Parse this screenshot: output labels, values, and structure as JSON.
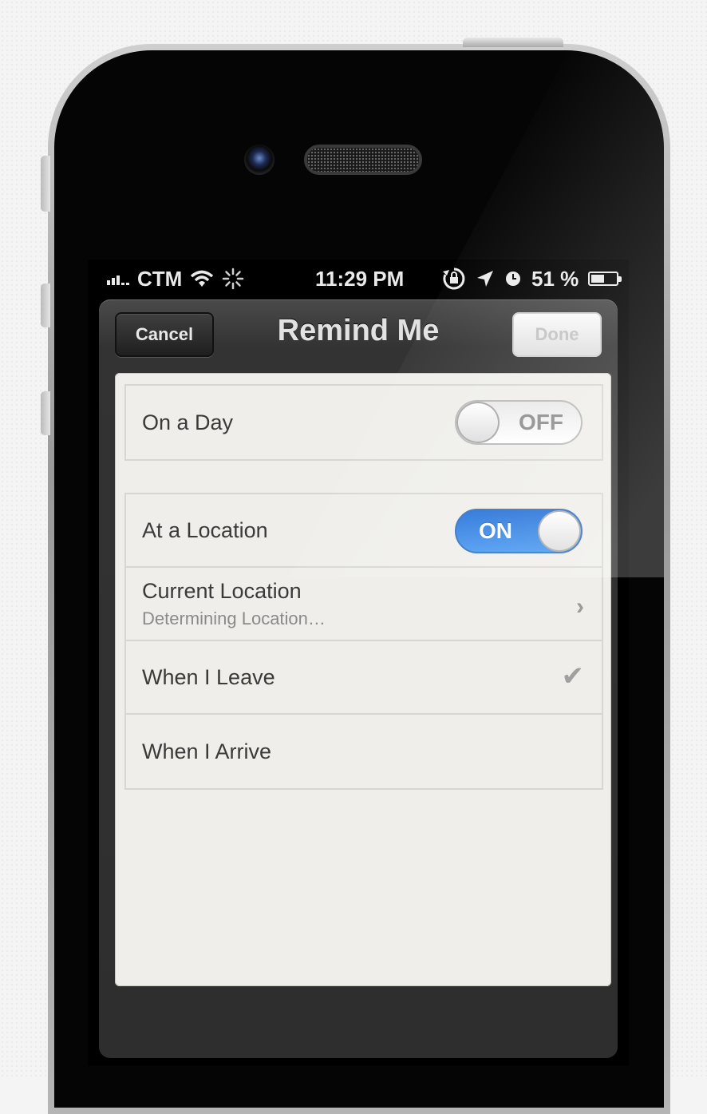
{
  "status_bar": {
    "carrier": "CTM",
    "time": "11:29 PM",
    "battery_percent": "51 %",
    "battery_level": 0.51
  },
  "nav": {
    "title": "Remind Me",
    "cancel_label": "Cancel",
    "done_label": "Done"
  },
  "on_day": {
    "label": "On a Day",
    "toggle_label": "OFF"
  },
  "location": {
    "label": "At a Location",
    "toggle_label": "ON",
    "current_location_title": "Current Location",
    "current_location_sub": "Determining Location…",
    "leave_label": "When I Leave",
    "arrive_label": "When I Arrive"
  },
  "icons": [
    "signal-icon",
    "wifi-icon",
    "activity-spinner-icon",
    "rotation-lock-icon",
    "location-arrow-icon",
    "alarm-clock-icon",
    "battery-icon",
    "chevron-right-icon",
    "checkmark-icon"
  ],
  "colors": {
    "toggle_on": "#2f80e8"
  }
}
